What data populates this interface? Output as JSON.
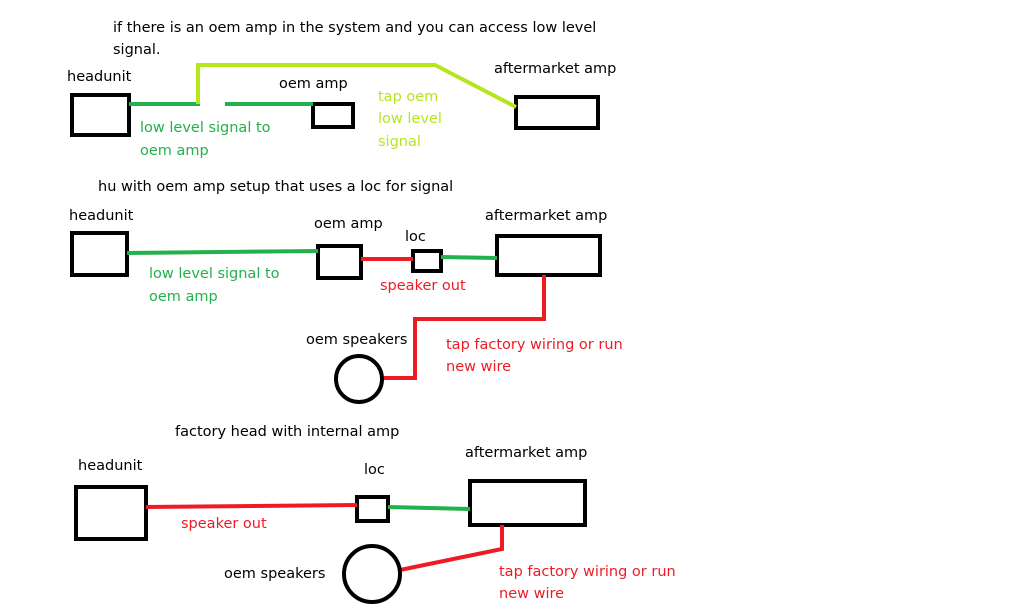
{
  "colors": {
    "black": "#000000",
    "green": "#22b14c",
    "lime": "#b5e61d",
    "red": "#ed1c24"
  },
  "section1": {
    "title_line1": "if there is an oem amp in the system and you can access low level",
    "title_line2": "signal.",
    "headunit": "headunit",
    "oem_amp": "oem amp",
    "aftermarket_amp": "aftermarket amp",
    "wire_label_line1": "low level signal to",
    "wire_label_line2": "oem amp",
    "tap_label_line1": "tap oem",
    "tap_label_line2": "low level",
    "tap_label_line3": "signal"
  },
  "section2": {
    "title": "hu with oem amp setup that uses a loc for signal",
    "headunit": "headunit",
    "oem_amp": "oem amp",
    "loc": "loc",
    "aftermarket_amp": "aftermarket amp",
    "wire_label_line1": "low level signal to",
    "wire_label_line2": "oem amp",
    "speaker_out": "speaker out",
    "oem_speakers": "oem speakers",
    "tap_label_line1": "tap factory wiring or run",
    "tap_label_line2": "new wire"
  },
  "section3": {
    "title": "factory head with internal amp",
    "headunit": "headunit",
    "loc": "loc",
    "aftermarket_amp": "aftermarket amp",
    "speaker_out": "speaker out",
    "oem_speakers": "oem speakers",
    "tap_label_line1": "tap factory wiring or run",
    "tap_label_line2": "new wire"
  }
}
